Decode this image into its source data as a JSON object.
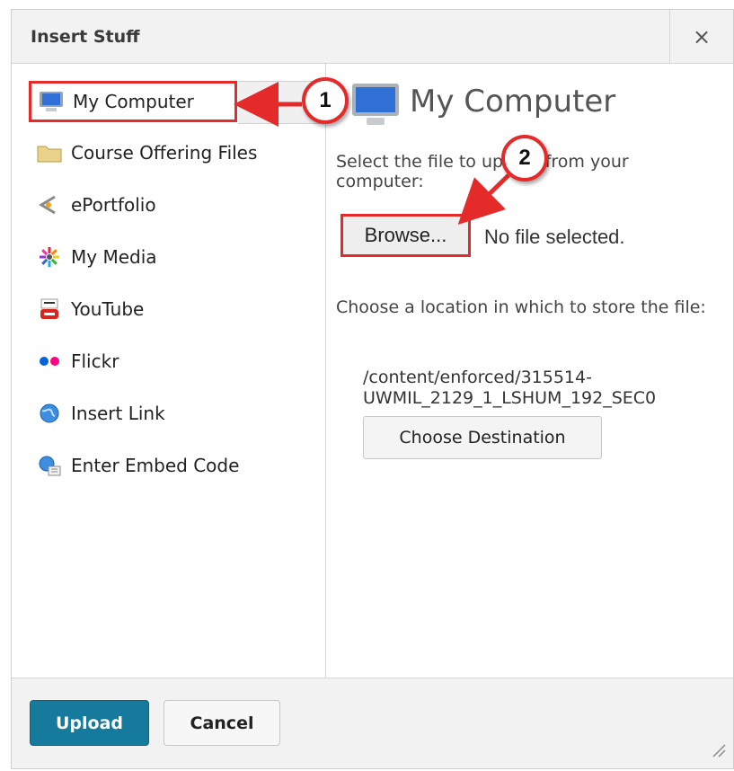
{
  "dialog": {
    "title": "Insert Stuff",
    "close_label": "×"
  },
  "sidebar": {
    "items": [
      {
        "label": "My Computer",
        "icon": "monitor-icon",
        "selected": true
      },
      {
        "label": "Course Offering Files",
        "icon": "folder-icon"
      },
      {
        "label": "ePortfolio",
        "icon": "eportfolio-icon"
      },
      {
        "label": "My Media",
        "icon": "media-icon"
      },
      {
        "label": "YouTube",
        "icon": "youtube-icon"
      },
      {
        "label": "Flickr",
        "icon": "flickr-icon"
      },
      {
        "label": "Insert Link",
        "icon": "globe-icon"
      },
      {
        "label": "Enter Embed Code",
        "icon": "embed-icon"
      }
    ]
  },
  "content": {
    "heading": "My Computer",
    "select_text": "Select the file to upload from your computer:",
    "browse_label": "Browse...",
    "no_file_text": "No file selected.",
    "location_text": "Choose a location in which to store the file:",
    "path_line1": "/content/enforced/315514-",
    "path_line2": "UWMIL_2129_1_LSHUM_192_SEC0",
    "choose_destination_label": "Choose Destination"
  },
  "footer": {
    "upload_label": "Upload",
    "cancel_label": "Cancel"
  },
  "annotations": {
    "step1": "1",
    "step2": "2",
    "accent_color": "#e52a2a"
  },
  "colors": {
    "upload_button": "#167a9c",
    "titlebar": "#f2f2f2"
  }
}
